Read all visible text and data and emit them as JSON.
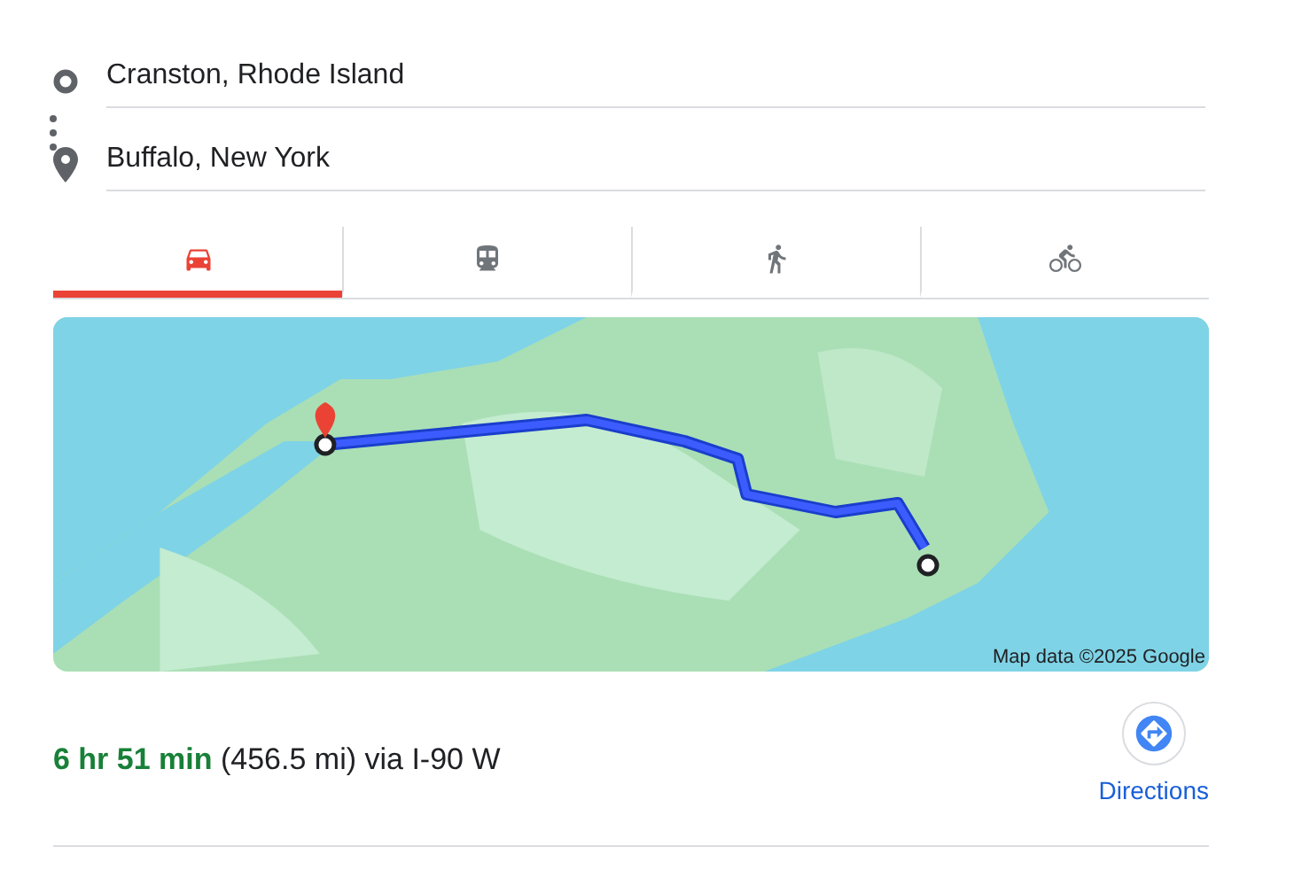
{
  "stops": [
    {
      "kind": "origin",
      "value": "Cranston, Rhode Island"
    },
    {
      "kind": "destination",
      "value": "Buffalo, New York"
    }
  ],
  "tabs": [
    {
      "kind": "drive",
      "selected": true
    },
    {
      "kind": "transit",
      "selected": false
    },
    {
      "kind": "walk",
      "selected": false
    },
    {
      "kind": "bike",
      "selected": false
    }
  ],
  "map": {
    "kind": "picture",
    "attribution": "Map data ©2025 Google"
  },
  "route": {
    "summary": "**6 hr 51 min** (456.5 mi) via I-90 W",
    "action": "Directions"
  }
}
